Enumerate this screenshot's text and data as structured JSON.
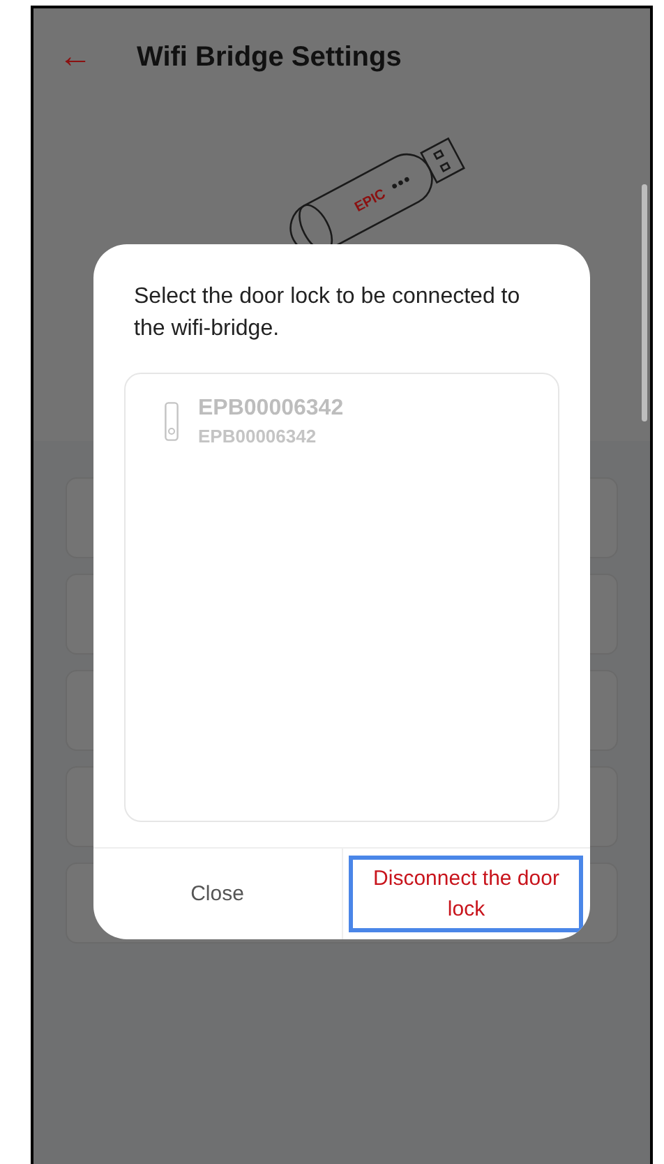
{
  "header": {
    "back_icon": "←",
    "title": "Wifi Bridge Settings"
  },
  "device": {
    "label": "EPIC"
  },
  "dialog": {
    "message": "Select the door lock to be connected to the wifi-bridge.",
    "locks": [
      {
        "name": "EPB00006342",
        "serial": "EPB00006342",
        "selected": false
      }
    ],
    "buttons": [
      {
        "label": "Close",
        "kind": "plain",
        "highlighted": false
      },
      {
        "label": "Disconnect the door lock",
        "kind": "danger",
        "highlighted": true
      }
    ]
  }
}
